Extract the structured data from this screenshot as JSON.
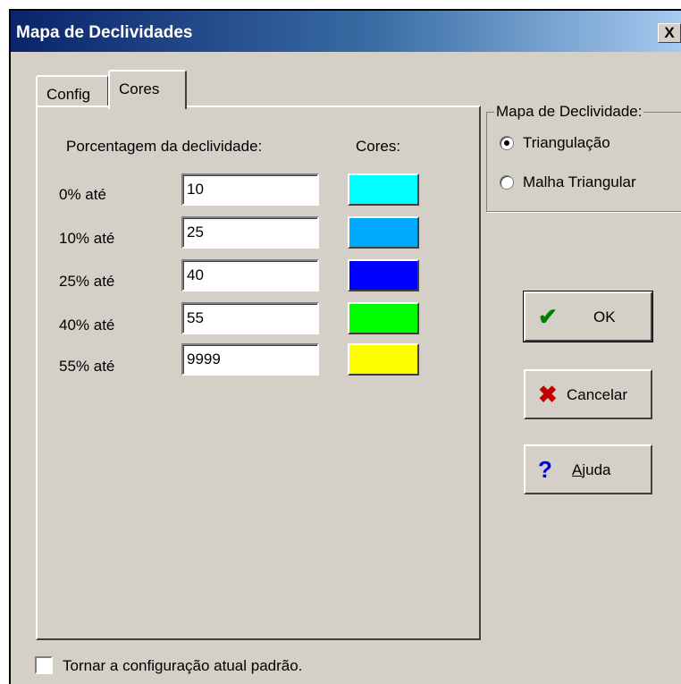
{
  "window": {
    "title": "Mapa de Declividades",
    "close_label": "X"
  },
  "tabs": [
    {
      "label": "Config"
    },
    {
      "label": "Cores"
    }
  ],
  "cores": {
    "header_percent": "Porcentagem da declividade:",
    "header_colors": "Cores:",
    "rows": [
      {
        "label": "0% até",
        "value": "10",
        "color": "#00ffff"
      },
      {
        "label": "10% até",
        "value": "25",
        "color": "#00aaff"
      },
      {
        "label": "25% até",
        "value": "40",
        "color": "#0000ff"
      },
      {
        "label": "40% até",
        "value": "55",
        "color": "#00ff00"
      },
      {
        "label": "55% até",
        "value": "9999",
        "color": "#ffff00"
      }
    ]
  },
  "group": {
    "title": "Mapa de Declividade:",
    "options": [
      {
        "label": "Triangulação",
        "selected": true
      },
      {
        "label": "Malha Triangular",
        "selected": false
      }
    ]
  },
  "buttons": {
    "ok": {
      "label": "OK",
      "icon": "check-icon",
      "color": "#008000"
    },
    "cancel": {
      "label": "Cancelar",
      "icon": "x-icon",
      "color": "#c00000"
    },
    "help": {
      "label": "Ajuda",
      "icon": "question-icon",
      "color": "#0000cc"
    }
  },
  "checkbox": {
    "label": "Tornar a configuração atual padrão.",
    "checked": false
  }
}
